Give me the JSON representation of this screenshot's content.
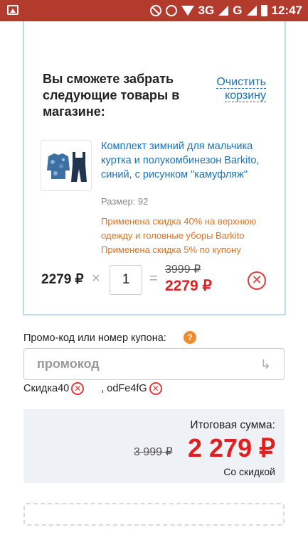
{
  "status_bar": {
    "network": "3G",
    "carrier_letter": "G",
    "time": "12:47",
    "colors": {
      "background": "#b23b2e"
    }
  },
  "cart": {
    "pickup_title": "Вы сможете забрать следующие товары в магазине:",
    "clear_link_line1": "Очистить",
    "clear_link_line2": "корзину",
    "product": {
      "name": "Комплект зимний для мальчика куртка и полукомбинезон Barkito, синий, с рисунком \"камуфляж\"",
      "size": "Размер: 92",
      "discounts": [
        "Применена скидка 40% на верхнюю одежду и головные уборы Barkito",
        "Применена скидка 5% по купону"
      ],
      "unit_price": "2279 ₽",
      "times_sign": "×",
      "quantity": "1",
      "equals_sign": "=",
      "old_price": "3999 ₽",
      "new_price": "2279 ₽",
      "remove_icon": "close-circle-icon"
    }
  },
  "promo": {
    "label": "Промо-код или номер купона:",
    "help_icon_text": "?",
    "placeholder": "промокод",
    "submit_icon": "return-arrow-icon",
    "applied": [
      {
        "code": "Скидка40"
      },
      {
        "code": ", odFe4fG"
      }
    ]
  },
  "total": {
    "label": "Итоговая сумма:",
    "old": "3 999 ₽",
    "new": "2 279 ₽",
    "note": "Со скидкой"
  },
  "colors": {
    "accent_red": "#e21e1e",
    "link_blue": "#1a72b8",
    "discount_orange": "#e5731c",
    "box_border": "#b9dcec"
  }
}
